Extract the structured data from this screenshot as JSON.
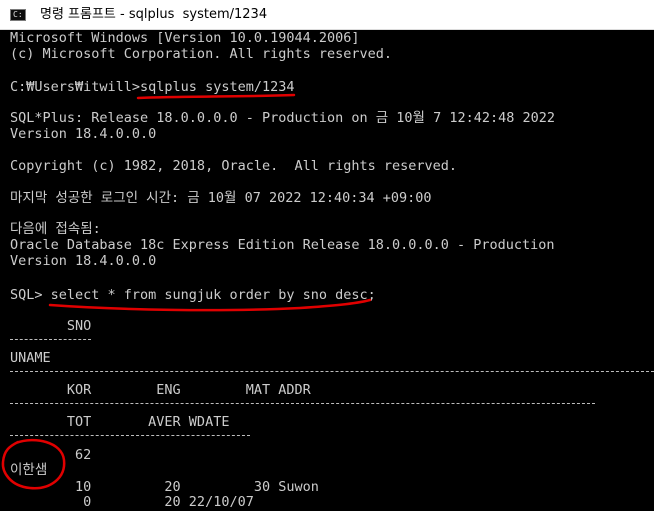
{
  "window": {
    "title": "명령 프롬프트 - sqlplus  system/1234",
    "icon_name": "cmd-icon"
  },
  "console": {
    "lines": [
      "Microsoft Windows [Version 10.0.19044.2006]",
      "(c) Microsoft Corporation. All rights reserved.",
      "C:₩Users₩itwill>sqlplus system/1234",
      "SQL*Plus: Release 18.0.0.0.0 - Production on 금 10월 7 12:42:48 2022",
      "Version 18.4.0.0.0",
      "Copyright (c) 1982, 2018, Oracle.  All rights reserved.",
      "마지막 성공한 로그인 시간: 금 10월 07 2022 12:40:34 +09:00",
      "다음에 접속됨:",
      "Oracle Database 18c Express Edition Release 18.0.0.0.0 - Production",
      "Version 18.4.0.0.0",
      "SQL> select * from sungjuk order by sno desc;",
      "       SNO",
      "UNAME",
      "       KOR        ENG        MAT ADDR",
      "       TOT       AVER WDATE",
      "        62",
      "이한샘",
      "        10         20         30 Suwon",
      "         0         20 22/10/07"
    ]
  },
  "annotation_color": "#e00000"
}
